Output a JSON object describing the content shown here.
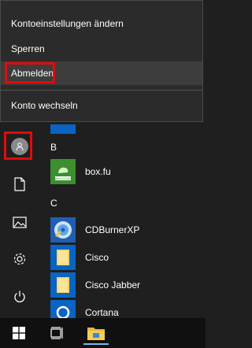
{
  "account_menu": {
    "items": [
      {
        "label": "Kontoeinstellungen ändern"
      },
      {
        "label": "Sperren"
      },
      {
        "label": "Abmelden"
      },
      {
        "label": "Konto wechseln"
      }
    ],
    "highlight_color": "#e10b0b"
  },
  "rail": {
    "icons": [
      "user-icon",
      "document-icon",
      "pictures-icon",
      "settings-icon",
      "power-icon"
    ]
  },
  "app_list": {
    "groups": [
      {
        "letter": "B",
        "apps": [
          {
            "label": "box.fu",
            "icon": "box-app-icon"
          }
        ]
      },
      {
        "letter": "C",
        "apps": [
          {
            "label": "CDBurnerXP",
            "icon": "cdburnerxp-icon"
          },
          {
            "label": "Cisco",
            "icon": "folder-icon"
          },
          {
            "label": "Cisco Jabber",
            "icon": "folder-icon"
          },
          {
            "label": "Cortana",
            "icon": "cortana-icon"
          }
        ]
      }
    ],
    "box_tile_text": "boxCLOUD"
  },
  "taskbar": {
    "icons": [
      "windows-start-icon",
      "task-view-icon",
      "file-explorer-icon"
    ]
  }
}
